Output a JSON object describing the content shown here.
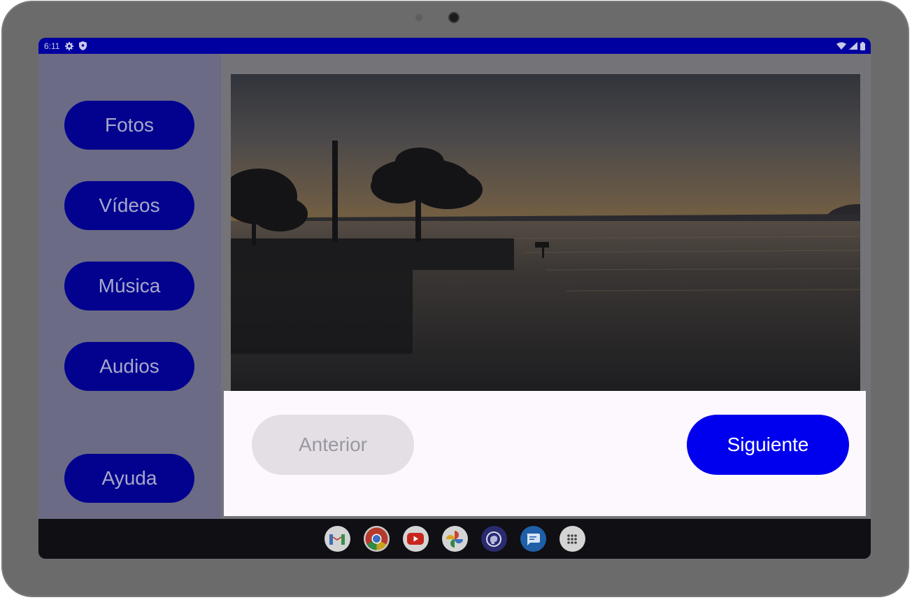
{
  "status_bar": {
    "time": "6:11",
    "left_icons": [
      "gear-icon",
      "shield-icon"
    ],
    "right_icons": [
      "wifi-icon",
      "cell-signal-icon",
      "battery-icon"
    ]
  },
  "sidebar": {
    "items": [
      {
        "label": "Fotos"
      },
      {
        "label": "Vídeos"
      },
      {
        "label": "Música"
      },
      {
        "label": "Audios"
      }
    ],
    "help_label": "Ayuda"
  },
  "viewer": {
    "image_icon": "sunset-lake-photo",
    "prev_label": "Anterior",
    "next_label": "Siguiente"
  },
  "taskbar": {
    "apps": [
      "gmail-icon",
      "chrome-icon",
      "youtube-icon",
      "photos-icon",
      "brain-app-icon",
      "messages-icon",
      "app-drawer-icon"
    ]
  },
  "colors": {
    "status_bar": "#0000a0",
    "nav_button": "#02028f",
    "next_button": "#0000ee",
    "prev_button_disabled": "#e3dfe5",
    "scrim": "#747378"
  }
}
